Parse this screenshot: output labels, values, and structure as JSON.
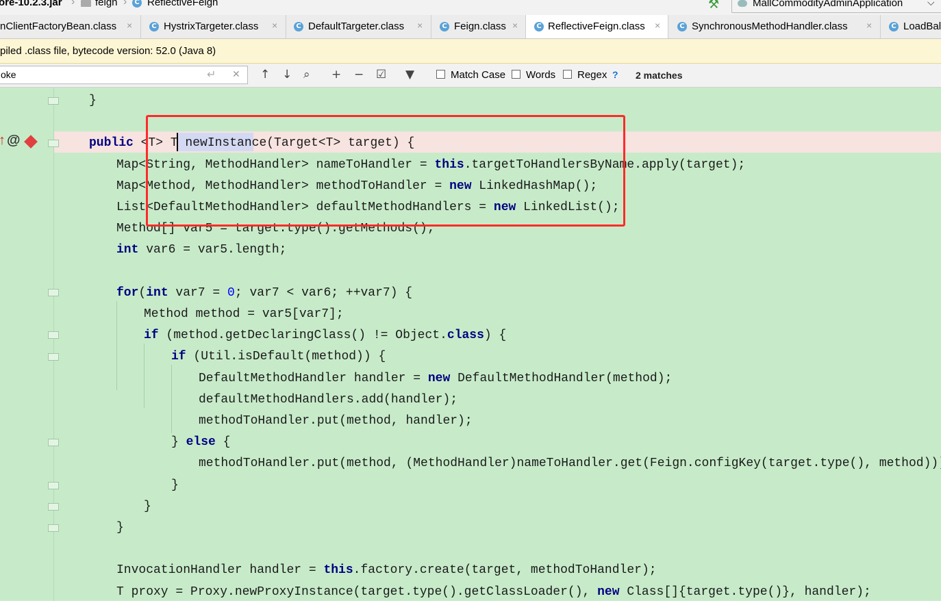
{
  "breadcrumb": {
    "jar": "ore-10.2.3.jar",
    "package": "feign",
    "class": "ReflectiveFeign"
  },
  "run_config": "MallCommodityAdminApplication",
  "tabs": [
    {
      "label": "nClientFactoryBean.class"
    },
    {
      "label": "HystrixTargeter.class"
    },
    {
      "label": "DefaultTargeter.class"
    },
    {
      "label": "Feign.class"
    },
    {
      "label": "ReflectiveFeign.class",
      "active": true
    },
    {
      "label": "SynchronousMethodHandler.class"
    },
    {
      "label": "LoadBal"
    }
  ],
  "notice": "piled .class file, bytecode version: 52.0 (Java 8)",
  "find": {
    "query": "oke",
    "match_case": "Match Case",
    "words": "Words",
    "regex": "Regex",
    "help": "?",
    "matches": "2 matches"
  },
  "code": [
    "}",
    "",
    "public <T> T newInstance(Target<T> target) {",
    "Map<String, MethodHandler> nameToHandler = this.targetToHandlersByName.apply(target);",
    "Map<Method, MethodHandler> methodToHandler = new LinkedHashMap();",
    "List<DefaultMethodHandler> defaultMethodHandlers = new LinkedList();",
    "Method[] var5 = target.type().getMethods();",
    "int var6 = var5.length;",
    "",
    "for(int var7 = 0; var7 < var6; ++var7) {",
    "Method method = var5[var7];",
    "if (method.getDeclaringClass() != Object.class) {",
    "if (Util.isDefault(method)) {",
    "DefaultMethodHandler handler = new DefaultMethodHandler(method);",
    "defaultMethodHandlers.add(handler);",
    "methodToHandler.put(method, handler);",
    "} else {",
    "methodToHandler.put(method, (MethodHandler)nameToHandler.get(Feign.configKey(target.type(), method)));",
    "}",
    "}",
    "}",
    "",
    "InvocationHandler handler = this.factory.create(target, methodToHandler);",
    "T proxy = Proxy.newProxyInstance(target.type().getClassLoader(), new Class[]{target.type()}, handler);"
  ],
  "colors": {
    "editor_bg": "#c7ebc9",
    "keyword": "#000080",
    "annotation_box": "#ff2a2a",
    "current_line": "#f7e3df"
  }
}
